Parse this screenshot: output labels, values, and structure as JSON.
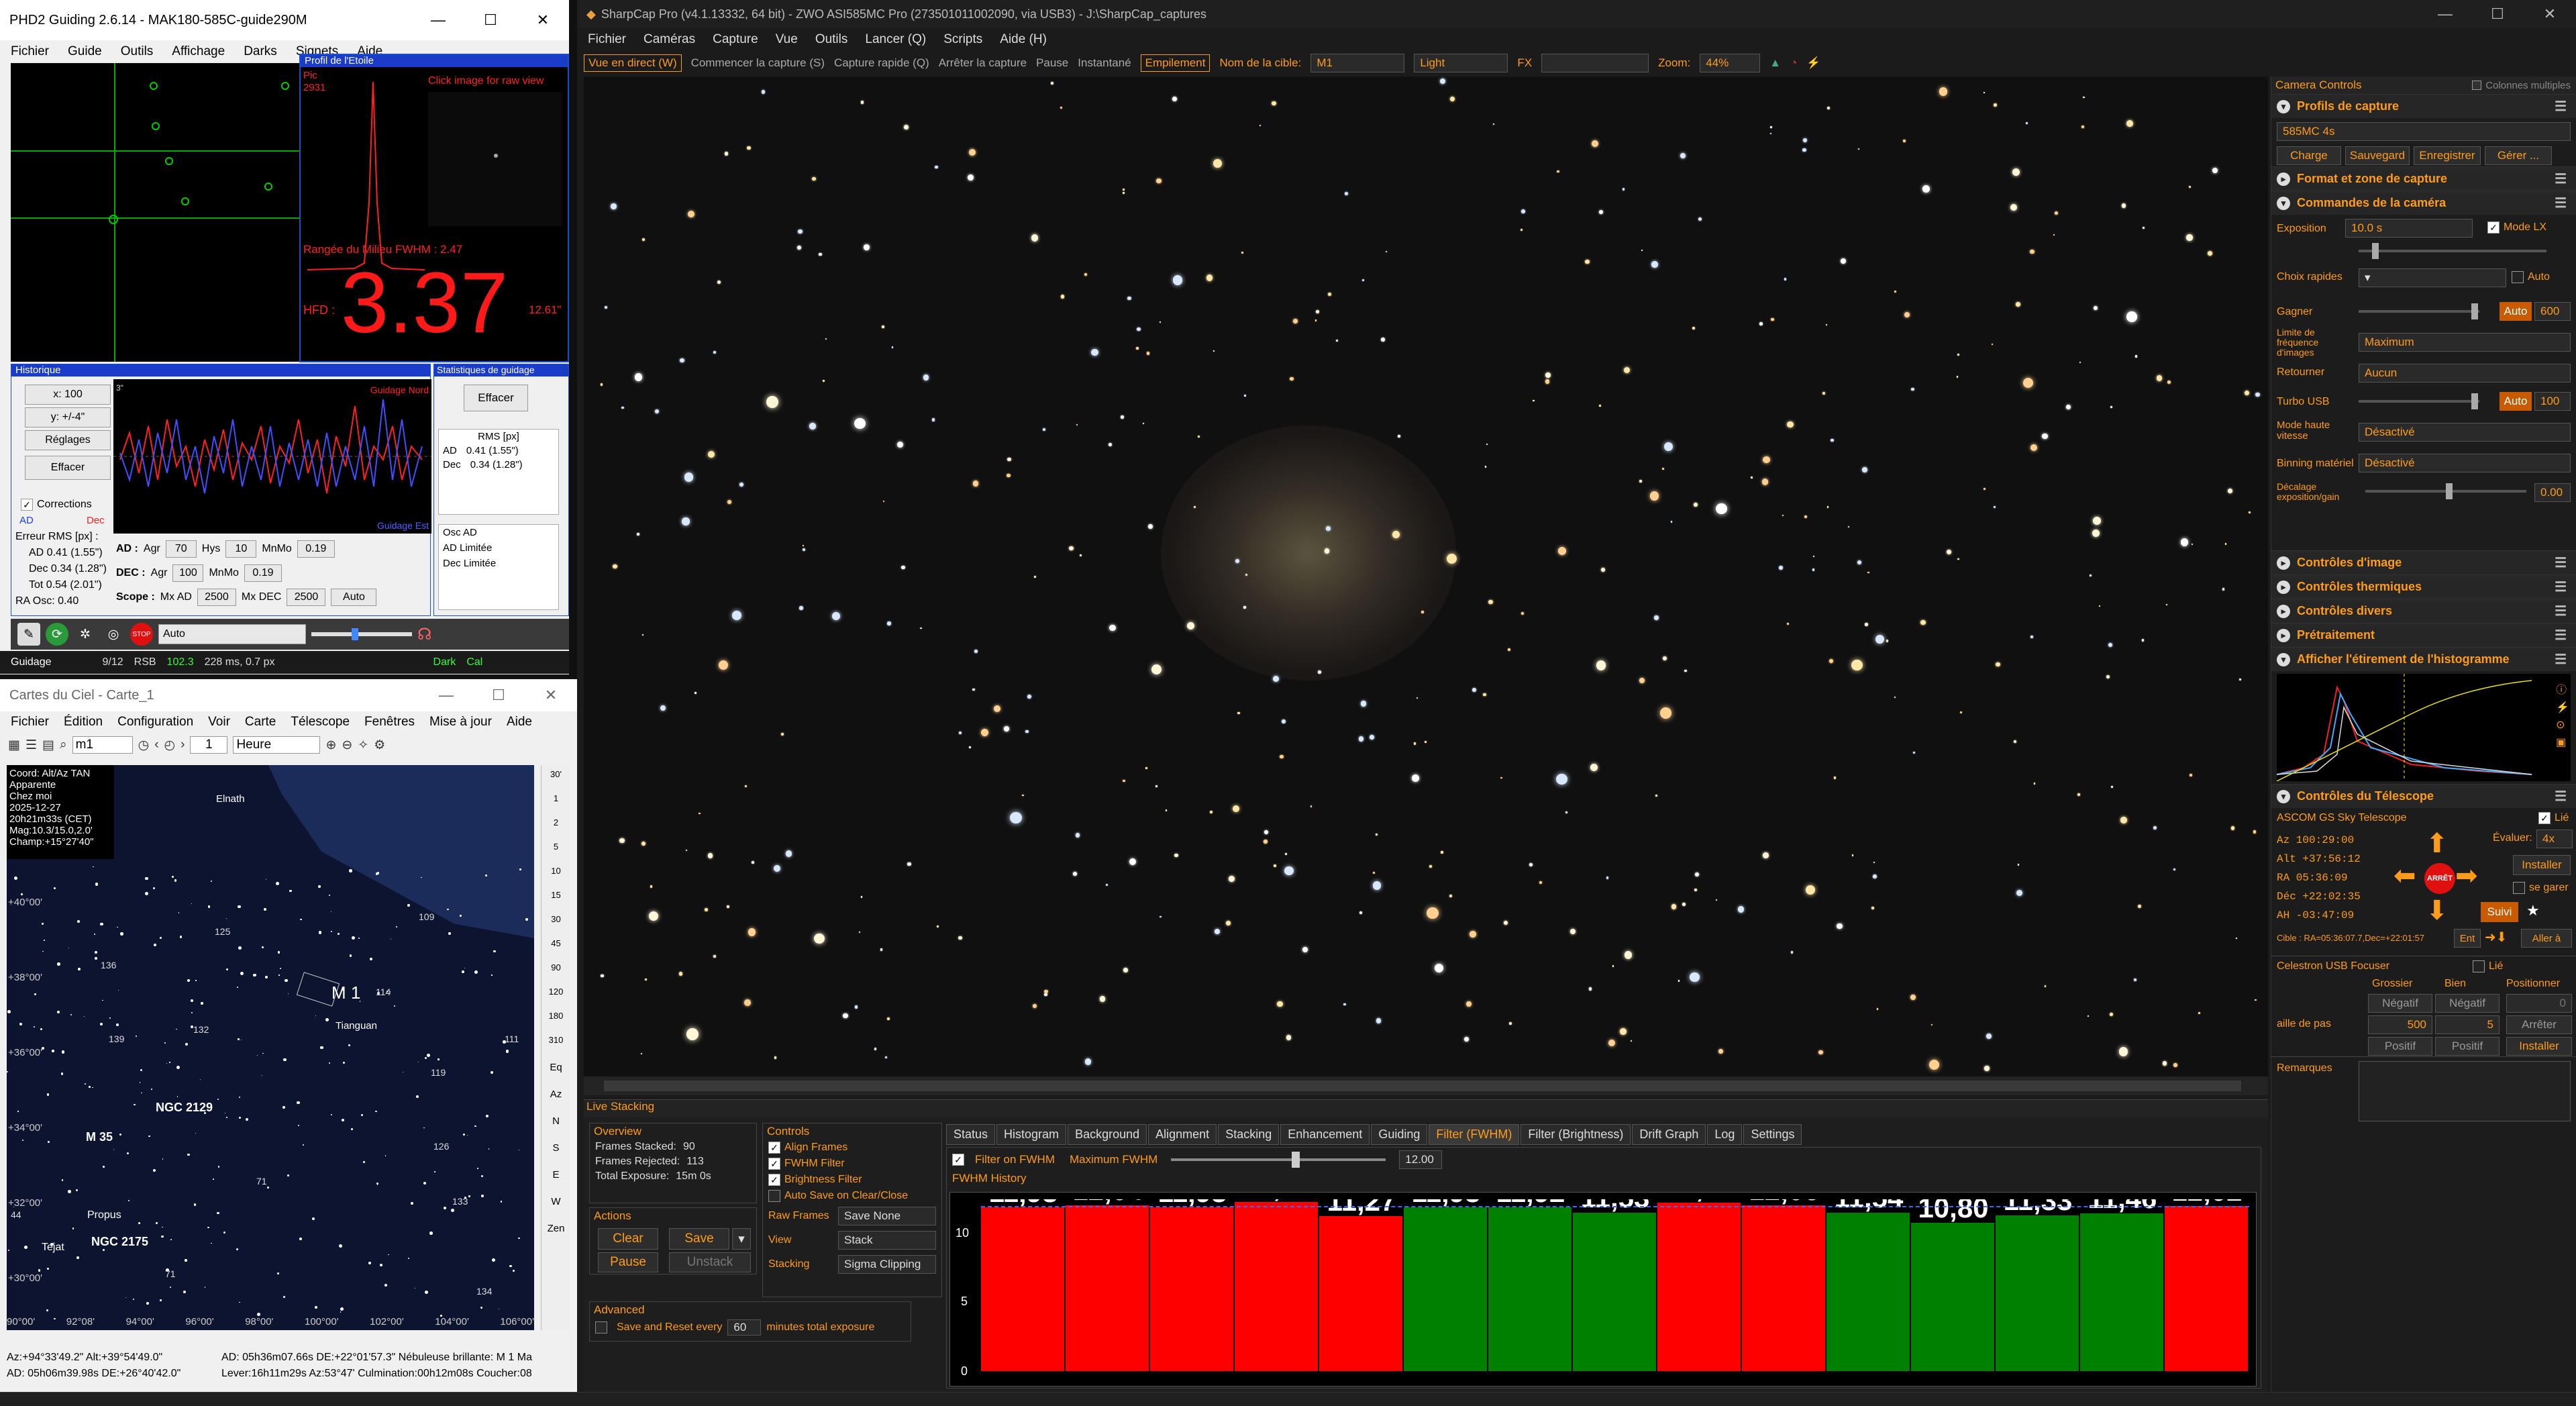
{
  "phd2": {
    "title": "PHD2 Guiding 2.6.14 - MAK180-585C-guide290M",
    "menu": [
      "Fichier",
      "Guide",
      "Outils",
      "Affichage",
      "Darks",
      "Signets",
      "Aide"
    ],
    "profile": {
      "title": "Profil de l'Etoile",
      "click_hint": "Click image for raw view",
      "pic_label": "Pic",
      "pic_value": "2931",
      "fwhm": "Rangée du Milieu FWHM : 2.47",
      "hfd_label": "HFD :",
      "hfd_value": "3.37",
      "hfd_arcsec": "12.61\""
    },
    "history": {
      "title": "Historique",
      "x_scale": "x: 100",
      "y_scale": "y: +/-4\"",
      "settings": "Réglages",
      "clear": "Effacer",
      "corrections": "Corrections",
      "ad": "AD",
      "dec": "Dec",
      "guidage_nord": "Guidage Nord",
      "guidage_est": "Guidage Est",
      "y_top": "3\"",
      "rms_title": "Erreur RMS [px] :",
      "ad_rms": "AD 0.41 (1.55\")",
      "dec_rms": "Dec 0.34 (1.28\")",
      "tot_rms": "Tot 0.54 (2.01\")",
      "ra_osc": "RA Osc: 0.40"
    },
    "stats": {
      "title": "Statistiques de guidage",
      "clear": "Effacer",
      "col": "RMS [px]",
      "rows": [
        {
          "k": "AD",
          "v": "0.41 (1.55\")"
        },
        {
          "k": "Dec",
          "v": "0.34 (1.28\")"
        }
      ],
      "lower": [
        "Osc AD",
        "AD Limitée",
        "Dec Limitée"
      ]
    },
    "params": {
      "ad_label": "AD :",
      "agr": "Agr",
      "ad_agr": "70",
      "hys": "Hys",
      "ad_hys": "10",
      "mnmo": "MnMo",
      "ad_mnmo": "0.19",
      "dec_label": "DEC :",
      "dec_agr": "100",
      "dec_mnmo": "0.19",
      "scope_label": "Scope :",
      "mx_ad_label": "Mx AD",
      "mx_ad": "2500",
      "mx_dec_label": "Mx DEC",
      "mx_dec": "2500",
      "auto": "Auto"
    },
    "toolbar": {
      "mode": "Auto"
    },
    "status": {
      "guidage": "Guidage",
      "frames": "9/12",
      "rsb_label": "RSB",
      "rsb": "102.3",
      "timing": "228 ms, 0.7 px",
      "dark": "Dark",
      "cal": "Cal"
    }
  },
  "cdc": {
    "title": "Cartes du Ciel - Carte_1",
    "menu": [
      "Fichier",
      "Édition",
      "Configuration",
      "Voir",
      "Carte",
      "Télescope",
      "Fenêtres",
      "Mise à jour",
      "Aide"
    ],
    "search": "m1",
    "step": "1",
    "unit": "Heure",
    "info": [
      "Coord: Alt/Az TAN",
      "Apparente",
      "Chez moi",
      "2025-12-27",
      "20h21m33s (CET)",
      "Mag:10.3/15.0,2.0'",
      "Champ:+15°27'40\""
    ],
    "labels": {
      "elnath": "Elnath",
      "m1": "M 1",
      "tianguan": "Tianguan",
      "ngc2129": "NGC 2129",
      "m35": "M 35",
      "propus": "Propus",
      "tejat": "Tejat",
      "ngc2175": "NGC 2175"
    },
    "star_nums": [
      "136",
      "125",
      "109",
      "114",
      "132",
      "139",
      "111",
      "119",
      "126",
      "133",
      "134",
      "71",
      "71",
      "44"
    ],
    "dec_labels": [
      "+40°00'",
      "+38°00'",
      "+36°00'",
      "+34°00'",
      "+32°00'",
      "+30°00'"
    ],
    "ra_labels": [
      "90°00'",
      "92°08'",
      "94°00'",
      "96°00'",
      "98°00'",
      "100°00'",
      "102°00'",
      "104°00'",
      "106°00'"
    ],
    "scale": [
      "30'",
      "1",
      "2",
      "5",
      "10",
      "15",
      "30",
      "45",
      "90",
      "120",
      "180",
      "310"
    ],
    "side": [
      "Eq",
      "Az",
      "N",
      "S",
      "E",
      "W",
      "Zen"
    ],
    "status1": "Az:+94°33'49.2\" Alt:+39°54'49.0\"",
    "status2": "AD: 05h36m07.66s DE:+22°01'57.3\"  Nébuleuse brillante: M 1  Ma",
    "status3": "AD: 05h06m39.98s DE:+26°40'42.0\"",
    "status4": "Lever:16h11m29s Az:53°47'  Culmination:00h12m08s  Coucher:08"
  },
  "sharpcap": {
    "title": "SharpCap Pro (v4.1.13332, 64 bit) - ZWO ASI585MC Pro (273501011002090, via USB3) - J:\\SharpCap_captures",
    "menu": [
      "Fichier",
      "Caméras",
      "Capture",
      "Vue",
      "Outils",
      "Lancer (Q)",
      "Scripts",
      "Aide (H)"
    ],
    "toolbar": {
      "live": "Vue en direct (W)",
      "start": "Commencer la capture (S)",
      "quick": "Capture rapide (Q)",
      "stop": "Arrêter la capture",
      "pause": "Pause",
      "snap": "Instantané",
      "stack": "Empilement",
      "target_label": "Nom de la cible:",
      "target": "M1",
      "frame_type": "Light",
      "fx": "FX",
      "zoom_label": "Zoom:",
      "zoom": "44%"
    },
    "panel": {
      "title": "Camera Controls",
      "multi": "Colonnes multiples",
      "profiles": "Profils de capture",
      "profile_sel": "585MC 4s",
      "charge": "Charge",
      "save": "Sauvegard",
      "register": "Enregistrer",
      "manage": "Gérer ...",
      "format": "Format et zone de capture",
      "commands": "Commandes de la caméra",
      "exposure_label": "Exposition",
      "exposure": "10.0 s",
      "lx": "Mode LX",
      "quick_label": "Choix rapides",
      "auto": "Auto",
      "gain_label": "Gagner",
      "gain": "600",
      "gain_auto": "Auto",
      "frame_limit_label": "Limite de fréquence d'images",
      "frame_limit": "Maximum",
      "flip_label": "Retourner",
      "flip": "Aucun",
      "turbo_label": "Turbo USB",
      "turbo_auto": "Auto",
      "turbo": "100",
      "hispeed_label": "Mode haute vitesse",
      "hispeed": "Désactivé",
      "binning_label": "Binning matériel",
      "binning": "Désactivé",
      "offset_label": "Décalage exposition/gain",
      "offset": "0.00",
      "img_ctrl": "Contrôles d'image",
      "thermal": "Contrôles thermiques",
      "misc": "Contrôles divers",
      "preproc": "Prétraitement",
      "histo": "Afficher l'étirement de l'histogramme",
      "telescope": "Contrôles du Télescope",
      "scope_name": "ASCOM GS Sky Telescope",
      "linked": "Lié",
      "evaluate": "Évaluer:",
      "rate": "4x",
      "install": "Installer",
      "az": "Az   100:29:00",
      "alt": "Alt  +37:56:12",
      "ra": "RA   05:36:09",
      "dec": "Déc  +22:02:35",
      "ah": "AH   -03:47:09",
      "stop": "ARRÊT",
      "park": "se garer",
      "track": "Suivi",
      "target": "Cible : RA=05:36:07.7,Dec=+22:01:57",
      "enter": "Ent",
      "goto": "Aller à",
      "focuser": "Celestron USB Focuser",
      "f_linked": "Lié",
      "coarse": "Grossier",
      "fine": "Bien",
      "position": "Positionner",
      "neg": "Négatif",
      "neg2": "Négatif",
      "pos_val": "0",
      "step_label": "aille de pas",
      "coarse_step": "500",
      "fine_step": "5",
      "f_stop": "Arrêter",
      "pos1": "Positif",
      "pos2": "Positif",
      "f_install": "Installer",
      "remarks": "Remarques"
    },
    "live": {
      "title": "Live Stacking",
      "overview": "Overview",
      "stacked_label": "Frames Stacked:",
      "stacked": "90",
      "rejected_label": "Frames Rejected:",
      "rejected": "113",
      "total_label": "Total Exposure:",
      "total": "15m 0s",
      "actions": "Actions",
      "clear": "Clear",
      "save": "Save",
      "pause": "Pause",
      "unstack": "Unstack",
      "controls": "Controls",
      "align": "Align Frames",
      "fwhm_filter": "FWHM Filter",
      "bright_filter": "Brightness Filter",
      "autosave": "Auto Save on Clear/Close",
      "raw_label": "Raw Frames",
      "raw": "Save None",
      "view_label": "View",
      "view": "Stack",
      "stacking_label": "Stacking",
      "stacking": "Sigma Clipping",
      "advanced": "Advanced",
      "save_reset": "Save and Reset every",
      "minutes": "60",
      "minutes_label": "minutes total exposure",
      "tabs": [
        "Status",
        "Histogram",
        "Background",
        "Alignment",
        "Stacking",
        "Enhancement",
        "Guiding",
        "Filter (FWHM)",
        "Filter (Brightness)",
        "Drift Graph",
        "Log",
        "Settings"
      ],
      "filter_on": "Filter on FWHM",
      "max_label": "Maximum FWHM",
      "max_value": "12.00",
      "history": "FWHM History",
      "y10": "10",
      "y5": "5",
      "y0": "0"
    }
  },
  "chart_data": {
    "type": "bar",
    "title": "FWHM History",
    "values": [
      11.93,
      12.04,
      11.93,
      12.3,
      11.27,
      11.93,
      11.92,
      11.53,
      12.25,
      12.06,
      11.54,
      10.8,
      11.33,
      11.46,
      12.02
    ],
    "status": [
      "rejected",
      "rejected",
      "rejected",
      "rejected",
      "rejected",
      "accepted",
      "accepted",
      "accepted",
      "rejected",
      "rejected",
      "accepted",
      "accepted",
      "accepted",
      "accepted",
      "rejected"
    ],
    "threshold": 12.0,
    "ylim": [
      0,
      12.5
    ],
    "colors": {
      "accepted": "#008000",
      "rejected": "#ff0000"
    }
  }
}
